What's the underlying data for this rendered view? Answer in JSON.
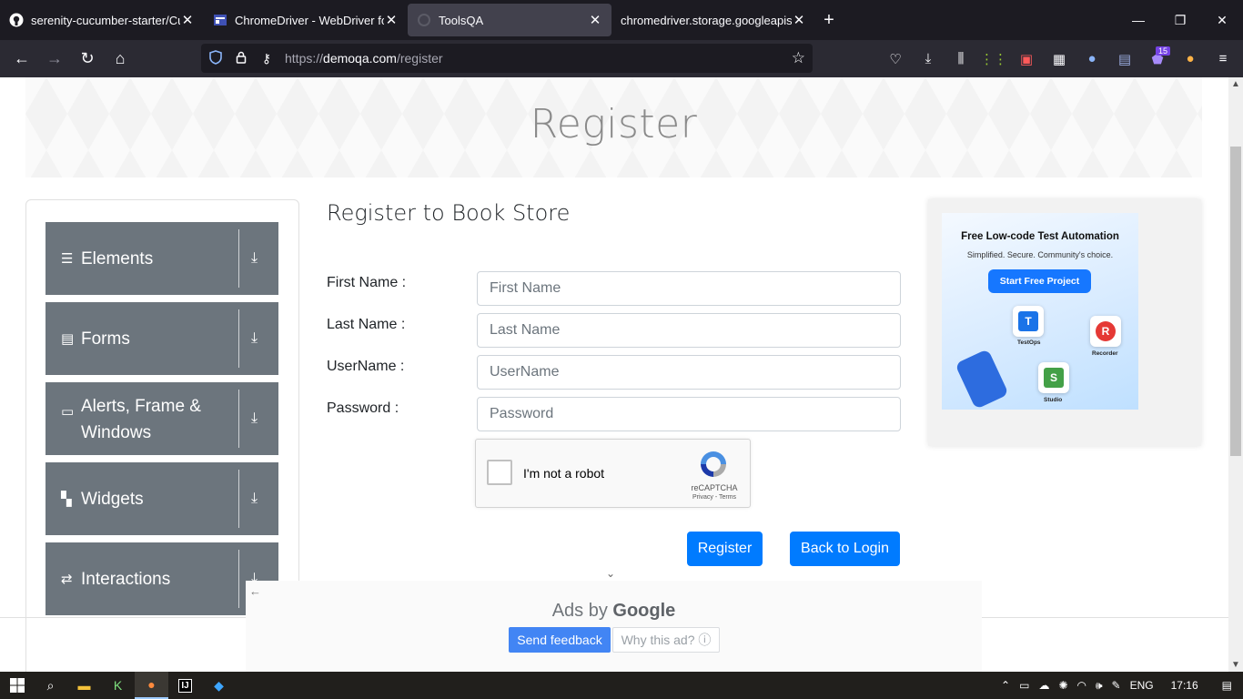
{
  "browser": {
    "tabs": [
      {
        "title": "serenity-cucumber-starter/Cuc",
        "icon": "github-icon",
        "active": false
      },
      {
        "title": "ChromeDriver - WebDriver for C",
        "icon": "chromedriver-icon",
        "active": false
      },
      {
        "title": "ToolsQA",
        "icon": "toolsqa-icon",
        "active": true
      },
      {
        "title": "chromedriver.storage.googleapis.co",
        "icon": "page-icon",
        "active": false
      }
    ],
    "url_scheme": "https://",
    "url_host": "demoqa.com",
    "url_path": "/register",
    "badge_count": "15"
  },
  "page": {
    "banner_title": "Register",
    "sidebar": {
      "groups": [
        {
          "label": "Elements",
          "icon": "hamburger-icon"
        },
        {
          "label": "Forms",
          "icon": "document-icon"
        },
        {
          "label": "Alerts, Frame & Windows",
          "icon": "window-icon"
        },
        {
          "label": "Widgets",
          "icon": "widgets-icon"
        },
        {
          "label": "Interactions",
          "icon": "interactions-icon"
        }
      ]
    },
    "form": {
      "title": "Register to Book Store",
      "fields": [
        {
          "label": "First Name :",
          "placeholder": "First Name"
        },
        {
          "label": "Last Name :",
          "placeholder": "Last Name"
        },
        {
          "label": "UserName :",
          "placeholder": "UserName"
        },
        {
          "label": "Password :",
          "placeholder": "Password"
        }
      ],
      "captcha_text": "I'm not a robot",
      "captcha_brand": "reCAPTCHA",
      "captcha_links": "Privacy - Terms",
      "register_label": "Register",
      "back_label": "Back to Login"
    },
    "ad": {
      "headline": "Free Low-code Test Automation",
      "subline": "Simplified. Secure. Community's choice.",
      "cta": "Start Free Project",
      "products": [
        "TestOps",
        "Recorder",
        "Studio"
      ]
    },
    "ad_footer": {
      "ads_by": "Ads by",
      "google": "Google",
      "send_feedback": "Send feedback",
      "why_ad": "Why this ad? ⓘ"
    }
  },
  "taskbar": {
    "language": "ENG",
    "time": "17:16"
  },
  "colors": {
    "primary_button": "#007bff",
    "sidebar_group": "#6c757d",
    "tab_strip": "#1c1b22",
    "nav_bar": "#2b2a33"
  }
}
